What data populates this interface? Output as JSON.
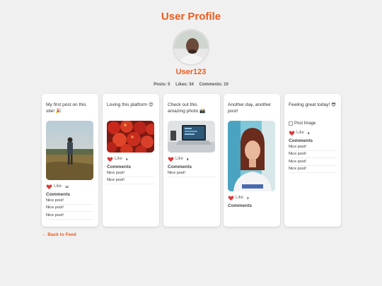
{
  "header": {
    "title": "User Profile",
    "username": "User123"
  },
  "stats": {
    "posts": "Posts: 5",
    "likes": "Likes: 34",
    "comments": "Comments: 10"
  },
  "posts": [
    {
      "caption": "My first post on this site! 🎉",
      "like_label": "Like",
      "likes": "12",
      "comments_heading": "Comments",
      "comments": [
        "Nice post!",
        "Nice post!",
        "Nice post!"
      ]
    },
    {
      "caption": "Loving this platform 😍",
      "like_label": "Like",
      "likes": "5",
      "comments_heading": "Comments",
      "comments": [
        "Nice post!",
        "Nice post!"
      ]
    },
    {
      "caption": "Check out this amazing photo 📸",
      "like_label": "Like",
      "likes": "8",
      "comments_heading": "Comments",
      "comments": [
        "Nice post!"
      ]
    },
    {
      "caption": "Another day, another post!",
      "like_label": "Like",
      "likes": "3",
      "comments_heading": "Comments",
      "comments": []
    },
    {
      "caption": "Feeling great today! 😎",
      "image_alt": "Post Image",
      "like_label": "Like",
      "likes": "6",
      "comments_heading": "Comments",
      "comments": [
        "Nice post!",
        "Nice post!",
        "Nice post!",
        "Nice post!"
      ]
    }
  ],
  "footer": {
    "back_link": "← Back to Feed"
  },
  "colors": {
    "accent": "#ee5a1c",
    "heart": "#e03a3a",
    "background": "#f0f0f0"
  },
  "icons": {
    "like": "heart-icon",
    "broken_image": "broken-image-icon"
  }
}
